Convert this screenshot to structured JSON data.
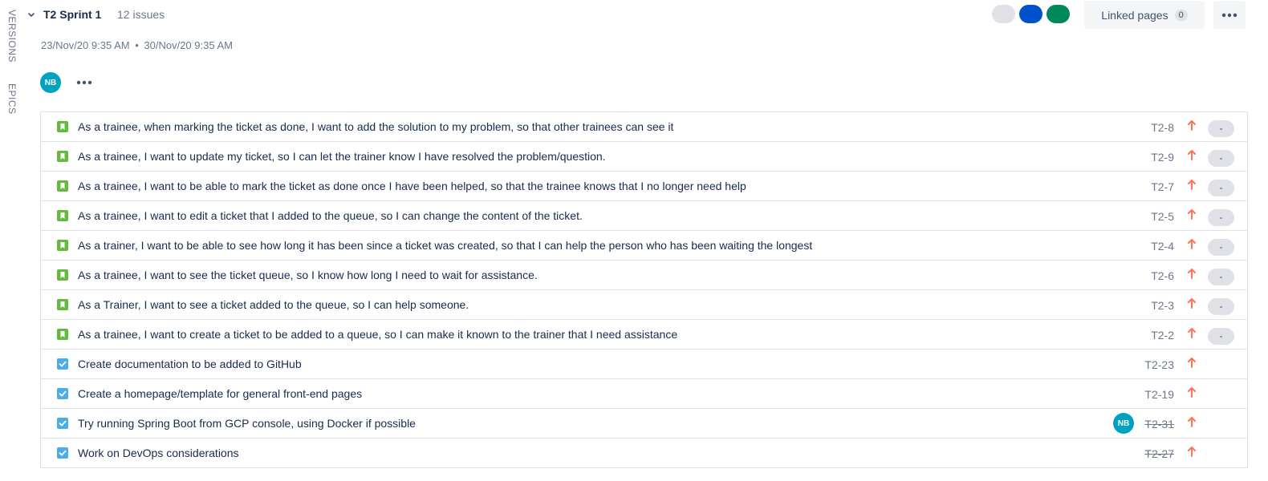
{
  "side_tabs": {
    "versions": "VERSIONS",
    "epics": "EPICS"
  },
  "sprint": {
    "name": "T2 Sprint 1",
    "issue_count": "12 issues",
    "start": "23/Nov/20 9:35 AM",
    "separator": "•",
    "end": "30/Nov/20 9:35 AM",
    "linked_pages_label": "Linked pages",
    "linked_pages_count": "0",
    "assignee_initials": "NB",
    "status_colors": {
      "todo": "#dfe1e6",
      "in_progress": "#0052cc",
      "done": "#00875a"
    }
  },
  "issues": [
    {
      "type": "story",
      "summary": "As a trainee, when marking the ticket as done, I want to add the solution to my problem, so that other trainees can see it",
      "key": "T2-8",
      "estimate": "-",
      "assignee": "",
      "done": false
    },
    {
      "type": "story",
      "summary": "As a trainee, I want to update my ticket, so I can let the trainer know I have resolved the problem/question.",
      "key": "T2-9",
      "estimate": "-",
      "assignee": "",
      "done": false
    },
    {
      "type": "story",
      "summary": "As a trainee, I want to be able to mark the ticket as done once I have been helped, so that the trainee knows that I no longer need help",
      "key": "T2-7",
      "estimate": "-",
      "assignee": "",
      "done": false
    },
    {
      "type": "story",
      "summary": "As a trainee, I want to edit a ticket that I added to the queue, so I can change the content of the ticket.",
      "key": "T2-5",
      "estimate": "-",
      "assignee": "",
      "done": false
    },
    {
      "type": "story",
      "summary": "As a trainer, I want to be able to see how long it has been since a ticket was created, so that I can help the person who has been waiting the longest",
      "key": "T2-4",
      "estimate": "-",
      "assignee": "",
      "done": false
    },
    {
      "type": "story",
      "summary": "As a trainee, I want to see the ticket queue, so I know how long I need to wait for assistance.",
      "key": "T2-6",
      "estimate": "-",
      "assignee": "",
      "done": false
    },
    {
      "type": "story",
      "summary": "As a Trainer, I want to see a ticket added to the queue, so I can help someone.",
      "key": "T2-3",
      "estimate": "-",
      "assignee": "",
      "done": false
    },
    {
      "type": "story",
      "summary": "As a trainee, I want to create a ticket to be added to a queue, so I can make it known to the trainer that I need assistance",
      "key": "T2-2",
      "estimate": "-",
      "assignee": "",
      "done": false
    },
    {
      "type": "task",
      "summary": "Create documentation to be added to GitHub",
      "key": "T2-23",
      "estimate": "",
      "assignee": "",
      "done": false
    },
    {
      "type": "task",
      "summary": "Create a homepage/template for general front-end pages",
      "key": "T2-19",
      "estimate": "",
      "assignee": "",
      "done": false
    },
    {
      "type": "task",
      "summary": "Try running Spring Boot from GCP console, using Docker if possible",
      "key": "T2-31",
      "estimate": "",
      "assignee": "NB",
      "done": true
    },
    {
      "type": "task",
      "summary": "Work on DevOps considerations",
      "key": "T2-27",
      "estimate": "",
      "assignee": "",
      "done": true
    }
  ],
  "icons": {
    "story": "bookmark-icon",
    "task": "checkbox-icon",
    "priority": "arrow-up-icon",
    "priority_color": "#ff7452"
  }
}
